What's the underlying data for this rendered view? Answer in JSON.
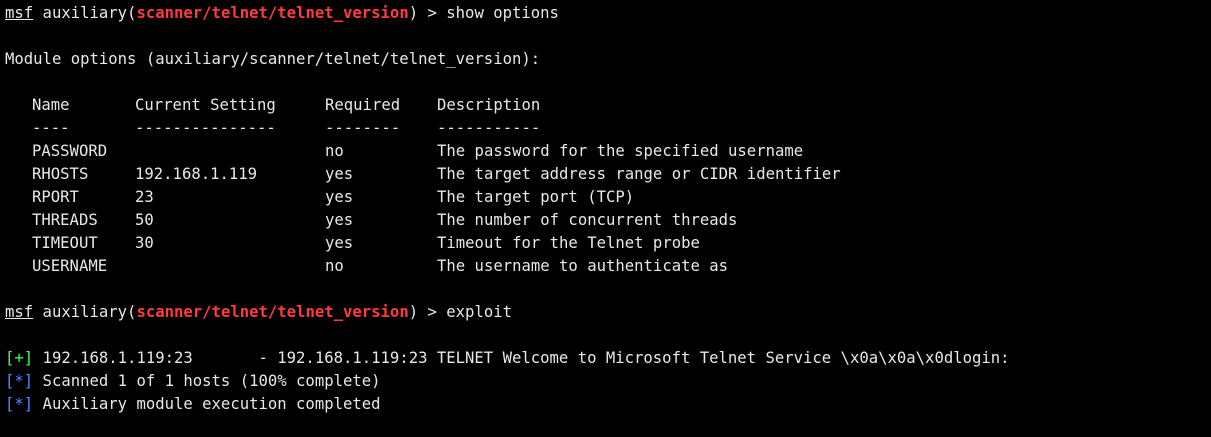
{
  "prompt1": {
    "msf": "msf",
    "pre": " auxiliary(",
    "module": "scanner/telnet/telnet_version",
    "post": ") > ",
    "command": "show options"
  },
  "module_options_header": "Module options (auxiliary/scanner/telnet/telnet_version):",
  "table": {
    "headers": [
      "Name",
      "Current Setting",
      "Required",
      "Description"
    ],
    "dashes": [
      "----",
      "---------------",
      "--------",
      "-----------"
    ],
    "rows": [
      {
        "name": "PASSWORD",
        "setting": "",
        "required": "no",
        "description": "The password for the specified username"
      },
      {
        "name": "RHOSTS",
        "setting": "192.168.1.119",
        "required": "yes",
        "description": "The target address range or CIDR identifier"
      },
      {
        "name": "RPORT",
        "setting": "23",
        "required": "yes",
        "description": "The target port (TCP)"
      },
      {
        "name": "THREADS",
        "setting": "50",
        "required": "yes",
        "description": "The number of concurrent threads"
      },
      {
        "name": "TIMEOUT",
        "setting": "30",
        "required": "yes",
        "description": "Timeout for the Telnet probe"
      },
      {
        "name": "USERNAME",
        "setting": "",
        "required": "no",
        "description": "The username to authenticate as"
      }
    ]
  },
  "prompt2": {
    "msf": "msf",
    "pre": " auxiliary(",
    "module": "scanner/telnet/telnet_version",
    "post": ") > ",
    "command": "exploit"
  },
  "output": [
    {
      "marker": "+",
      "text": " 192.168.1.119:23       - 192.168.1.119:23 TELNET Welcome to Microsoft Telnet Service \\x0a\\x0a\\x0dlogin:"
    },
    {
      "marker": "*",
      "text": " Scanned 1 of 1 hosts (100% complete)"
    },
    {
      "marker": "*",
      "text": " Auxiliary module execution completed"
    }
  ],
  "colors": {
    "background": "#000000",
    "text": "#e8e8e8",
    "module": "#ff3b3b",
    "success": "#4cff4c",
    "info": "#4f8cff"
  }
}
